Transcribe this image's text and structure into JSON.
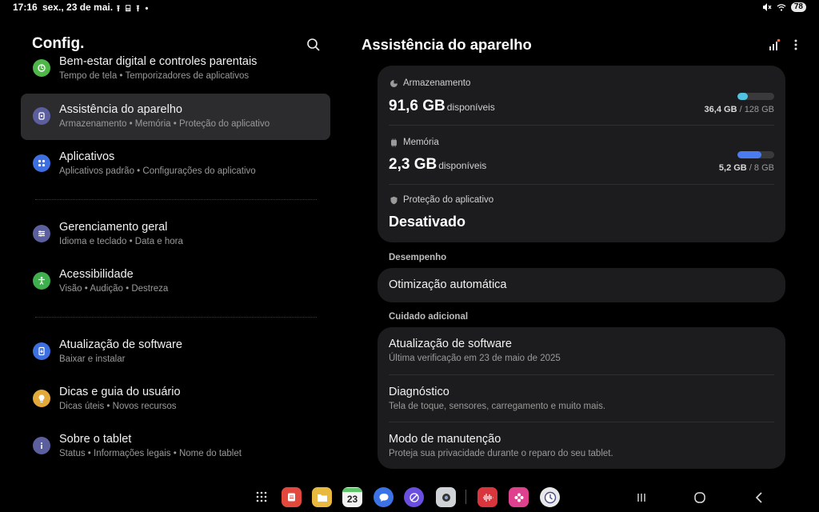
{
  "status_bar": {
    "time": "17:16",
    "date": "sex., 23 de mai.",
    "notifications": "⭱ ⌸ ⭱ •",
    "battery": "78"
  },
  "left": {
    "title": "Config.",
    "items": [
      {
        "title": "Bem-estar digital e controles parentais",
        "subtitle": "Tempo de tela  •  Temporizadores de aplicativos",
        "icon": "wellbeing-icon",
        "color": "#4fb64a"
      },
      {
        "title": "Assistência do aparelho",
        "subtitle": "Armazenamento  •  Memória  •  Proteção do aplicativo",
        "icon": "device-care-icon",
        "color": "#5c5f9e"
      },
      {
        "title": "Aplicativos",
        "subtitle": "Aplicativos padrão  •  Configurações do aplicativo",
        "icon": "apps-icon",
        "color": "#3d6fe0"
      },
      {
        "title": "Gerenciamento geral",
        "subtitle": "Idioma e teclado  •  Data e hora",
        "icon": "sliders-icon",
        "color": "#5c5f9e"
      },
      {
        "title": "Acessibilidade",
        "subtitle": "Visão  •  Audição  •  Destreza",
        "icon": "accessibility-icon",
        "color": "#3fae4d"
      },
      {
        "title": "Atualização de software",
        "subtitle": "Baixar e instalar",
        "icon": "software-update-icon",
        "color": "#3d6fe0"
      },
      {
        "title": "Dicas e guia do usuário",
        "subtitle": "Dicas úteis  •  Novos recursos",
        "icon": "lightbulb-icon",
        "color": "#e3a93b"
      },
      {
        "title": "Sobre o tablet",
        "subtitle": "Status  •  Informações legais  •  Nome do tablet",
        "icon": "info-icon",
        "color": "#5c5f9e"
      }
    ]
  },
  "right": {
    "title": "Assistência do aparelho",
    "storage": {
      "label": "Armazenamento",
      "value": "91,6 GB",
      "unit": "disponíveis",
      "used": "36,4 GB",
      "total": "/ 128 GB",
      "fraction": 0.284,
      "color": "#4fc3e0"
    },
    "memory": {
      "label": "Memória",
      "value": "2,3 GB",
      "unit": "disponíveis",
      "used": "5,2 GB",
      "total": "/ 8 GB",
      "fraction": 0.65,
      "color": "#4a7cf0"
    },
    "app_protection": {
      "label": "Proteção do aplicativo",
      "value": "Desativado"
    },
    "performance": {
      "section": "Desempenho",
      "auto_opt": "Otimização automática"
    },
    "additional": {
      "section": "Cuidado adicional",
      "items": [
        {
          "title": "Atualização de software",
          "subtitle": "Última verificação em 23 de maio de 2025"
        },
        {
          "title": "Diagnóstico",
          "subtitle": "Tela de toque, sensores, carregamento e muito mais."
        },
        {
          "title": "Modo de manutenção",
          "subtitle": "Proteja sua privacidade durante o reparo do seu tablet."
        }
      ]
    }
  },
  "taskbar": {
    "calendar_day": "23",
    "apps": [
      "notes-app",
      "files-app",
      "calendar-app",
      "messages-app",
      "internet-app",
      "camera-app",
      "voice-recorder-app",
      "gallery-app",
      "clock-app"
    ]
  }
}
